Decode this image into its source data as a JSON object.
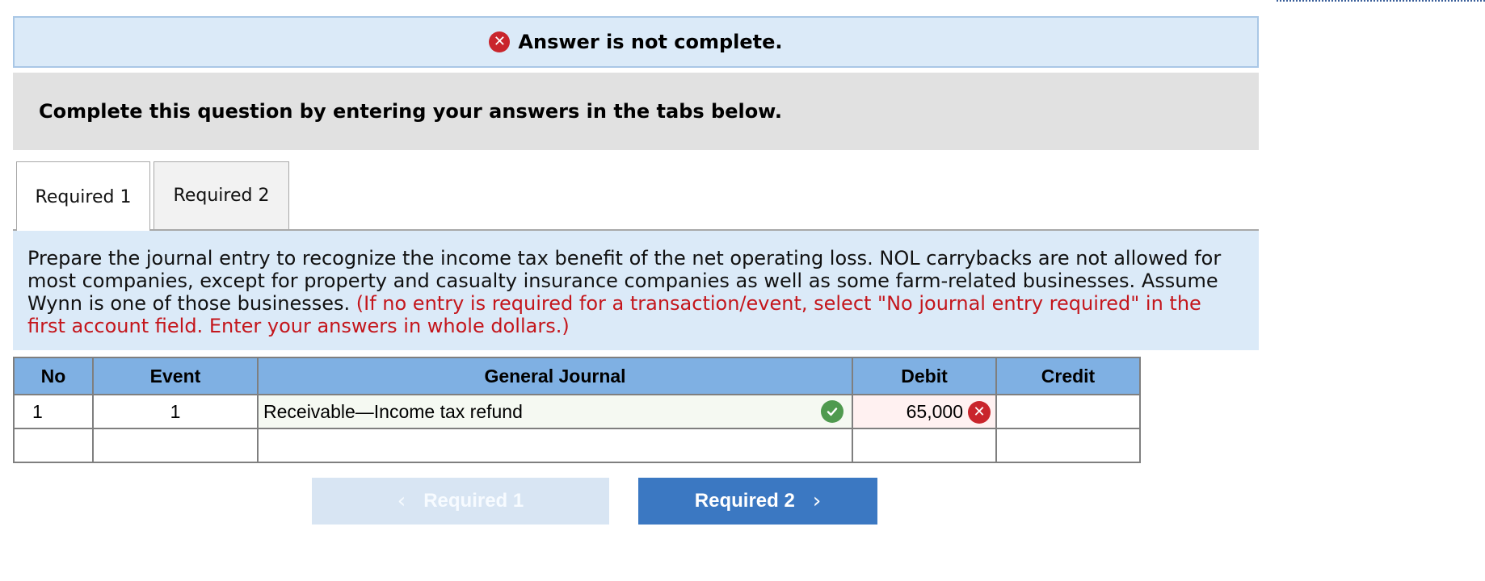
{
  "banner": {
    "status_text": "Answer is not complete.",
    "icon": "x-circle-icon"
  },
  "instructions": "Complete this question by entering your answers in the tabs below.",
  "tabs": [
    {
      "label": "Required 1",
      "active": true
    },
    {
      "label": "Required 2",
      "active": false
    }
  ],
  "prompt": {
    "text": "Prepare the journal entry to recognize the income tax benefit of the net operating loss. NOL carrybacks are not allowed for most companies, except for property and casualty insurance companies as well as some farm-related businesses. Assume Wynn is one of those businesses.",
    "note": "(If no entry is required for a transaction/event, select \"No journal entry required\" in the first account field. Enter your answers in whole dollars.)"
  },
  "journal": {
    "headers": [
      "No",
      "Event",
      "General Journal",
      "Debit",
      "Credit"
    ],
    "rows": [
      {
        "no": "1",
        "event": "1",
        "account": "Receivable—Income tax refund",
        "debit": "65,000",
        "credit": "",
        "account_status": "correct",
        "debit_status": "incorrect"
      },
      {
        "no": "",
        "event": "",
        "account": "",
        "debit": "",
        "credit": ""
      }
    ]
  },
  "nav": {
    "prev_label": "Required 1",
    "next_label": "Required 2",
    "prev_chevron": "‹",
    "next_chevron": "›"
  },
  "colors": {
    "banner_bg": "#dbeaf8",
    "error_red": "#c9252c",
    "success_green": "#4f9a4f",
    "table_header": "#7fb0e3",
    "primary_button": "#3b78c2"
  }
}
